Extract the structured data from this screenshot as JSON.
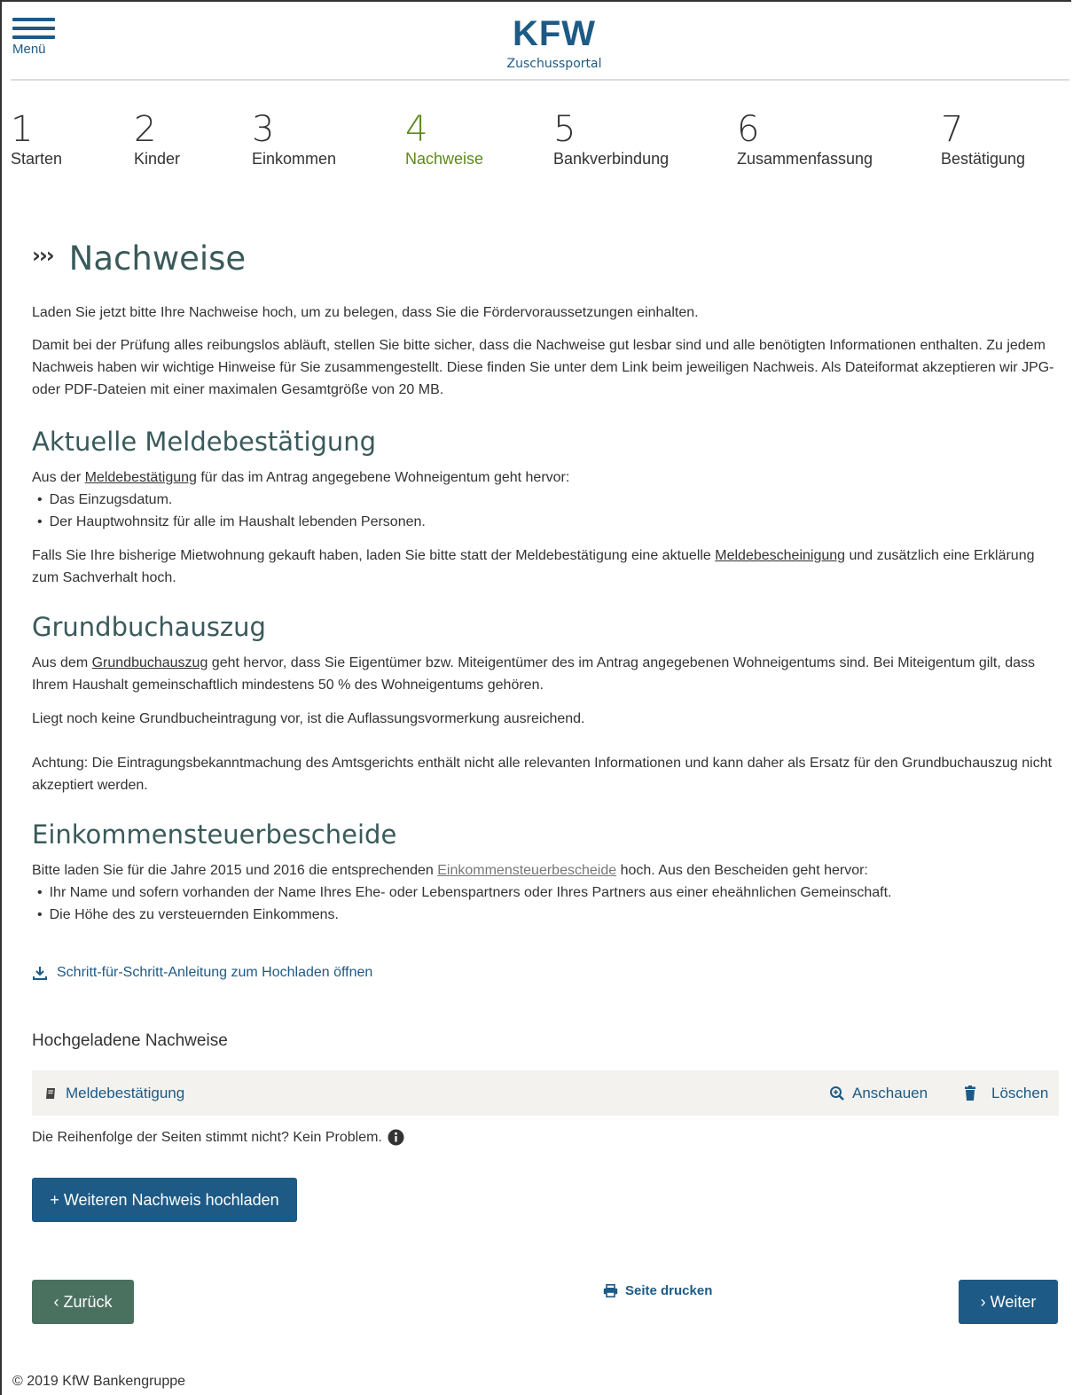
{
  "header": {
    "menu_label": "Menü",
    "logo_text": "KFW",
    "logo_sub": "Zuschussportal"
  },
  "steps": [
    {
      "num": "1",
      "label": "Starten"
    },
    {
      "num": "2",
      "label": "Kinder"
    },
    {
      "num": "3",
      "label": "Einkommen"
    },
    {
      "num": "4",
      "label": "Nachweise"
    },
    {
      "num": "5",
      "label": "Bankverbindung"
    },
    {
      "num": "6",
      "label": "Zusammenfassung"
    },
    {
      "num": "7",
      "label": "Bestätigung"
    }
  ],
  "active_step": "4",
  "colors": {
    "accent": "#1d5a86",
    "active_step": "#5d8a1c",
    "back_button": "#4a7060",
    "row_bg": "#f4f2ee"
  },
  "page": {
    "chevrons": "›››",
    "title": "Nachweise",
    "intro1": "Laden Sie jetzt bitte Ihre Nachweise hoch, um zu belegen, dass Sie die Fördervoraussetzungen einhalten.",
    "intro2": "Damit bei der Prüfung alles reibungslos abläuft, stellen Sie bitte sicher, dass die Nachweise gut lesbar sind und alle benötigten Informationen enthalten. Zu jedem Nachweis haben wir wichtige Hinweise für Sie zusammengestellt. Diese finden Sie unter dem Link beim jeweiligen Nachweis. Als Dateiformat akzeptieren wir JPG- oder PDF-Dateien mit einer maximalen Gesamtgröße von 20 MB."
  },
  "meldung": {
    "title": "Aktuelle Meldebestätigung",
    "p1_a": "Aus der ",
    "p1_link": "Meldebestätigung",
    "p1_b": " für das im Antrag angegebene Wohneigentum geht hervor:",
    "bullets": [
      "Das Einzugsdatum.",
      "Der Hauptwohnsitz für alle im Haushalt lebenden Personen."
    ],
    "p2_a": "Falls Sie Ihre bisherige Mietwohnung gekauft haben, laden Sie bitte statt der Meldebestätigung eine aktuelle ",
    "p2_link": "Meldebescheinigung",
    "p2_b": " und zusätzlich eine Erklärung zum Sachverhalt hoch."
  },
  "grundbuch": {
    "title": "Grundbuchauszug",
    "p1_a": "Aus dem ",
    "p1_link": "Grundbuchauszug",
    "p1_b": " geht hervor, dass Sie Eigentümer bzw. Miteigentümer des im Antrag angegebenen Wohneigentums sind. Bei Miteigentum gilt, dass Ihrem Haushalt gemeinschaftlich mindestens 50 % des Wohneigentums gehören.",
    "p2": "Liegt noch keine Grundbucheintragung vor, ist die Auflassungsvormerkung ausreichend.",
    "p3": "Achtung: Die Eintragungsbekanntmachung des Amtsgerichts enthält nicht alle relevanten Informationen und kann daher als Ersatz für den Grundbuchauszug nicht akzeptiert werden."
  },
  "einkommen": {
    "title": "Einkommensteuerbescheide",
    "p1_a": "Bitte laden Sie für die Jahre 2015 und 2016 die entsprechenden ",
    "p1_link": "Einkommensteuerbescheide",
    "p1_b": " hoch. Aus den Bescheiden geht hervor:",
    "bullets": [
      "Ihr Name und sofern vorhanden der Name Ihres Ehe- oder Lebenspartners oder Ihres Partners aus einer eheähnlichen Gemeinschaft.",
      "Die Höhe des zu versteuernden Einkommens."
    ]
  },
  "guide_link": "Schritt-für-Schritt-Anleitung zum Hochladen öffnen",
  "uploads": {
    "title": "Hochgeladene Nachweise",
    "item_name": "Meldebestätigung",
    "view_label": "Anschauen",
    "delete_label": "Löschen",
    "order_note": "Die Reihenfolge der Seiten stimmt nicht? Kein Problem."
  },
  "buttons": {
    "add_upload": "+ Weiteren Nachweis hochladen",
    "back": "‹  Zurück",
    "next": "›  Weiter",
    "print": "Seite drucken"
  },
  "footer": "© 2019 KfW Bankengruppe"
}
